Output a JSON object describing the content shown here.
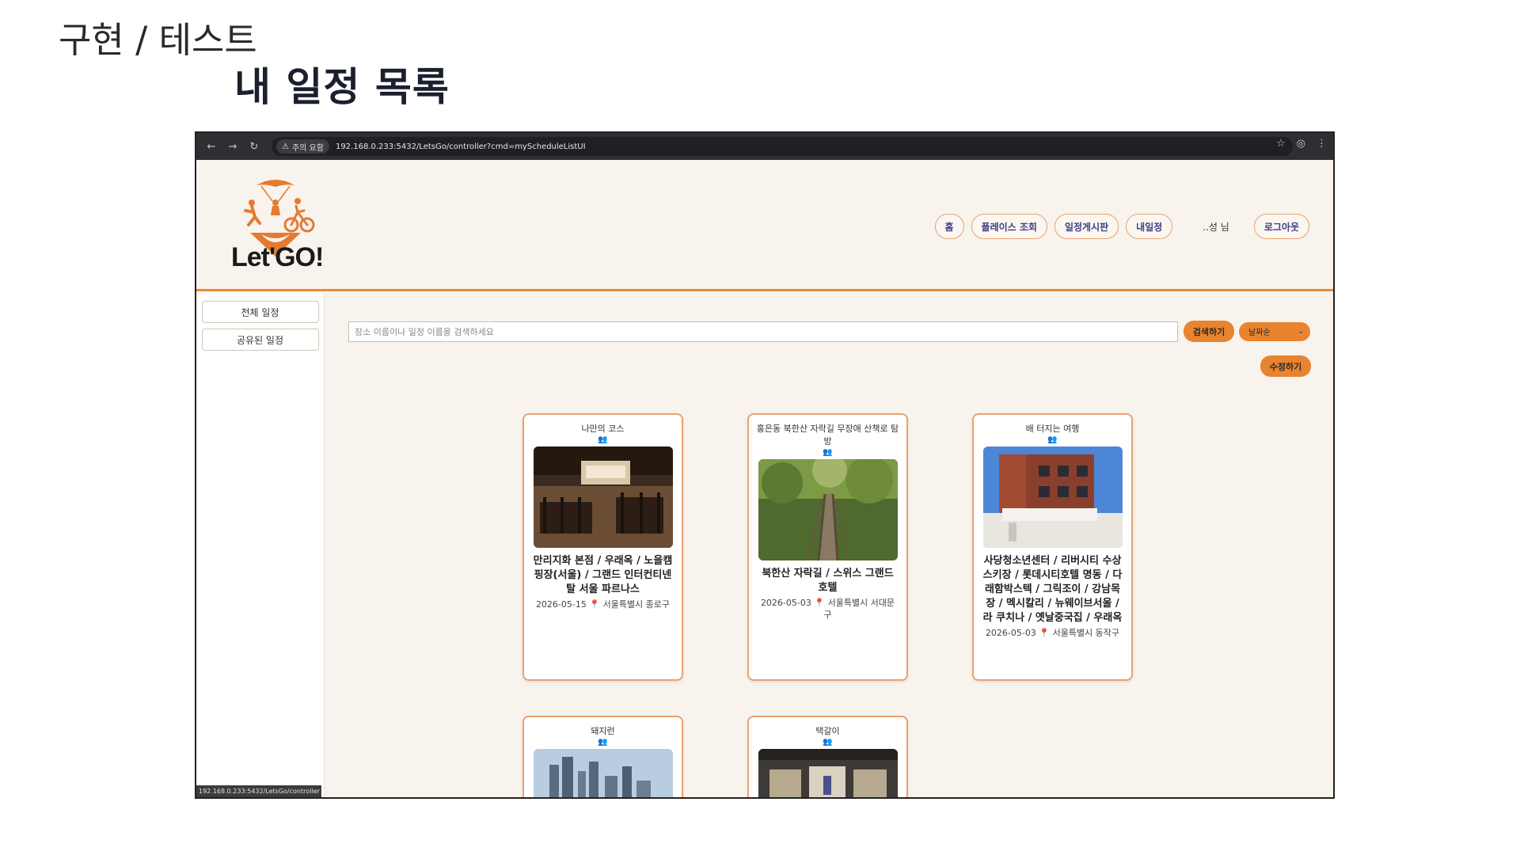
{
  "slide": {
    "title": "구현 / 테스트",
    "subtitle": "내 일정 목록"
  },
  "browser": {
    "warning": "주의 요함",
    "url": "192.168.0.233:5432/LetsGo/controller?cmd=myScheduleListUI",
    "status_url": "192.168.0.233:5432/LetsGo/controller"
  },
  "header": {
    "logo_text": "Let'GO!",
    "menu": [
      "홈",
      "플레이스 조회",
      "일정게시판",
      "내일정"
    ],
    "greeting": "..성 님",
    "logout": "로그아웃"
  },
  "sidebar": {
    "items": [
      "전체 일정",
      "공유된 일정"
    ]
  },
  "search": {
    "placeholder": "장소 이름이나 일정 이름을 검색하세요",
    "button": "검색하기",
    "sort": "날짜순"
  },
  "edit_button": "수정하기",
  "cards": [
    {
      "title": "나만의 코스",
      "places": "만리지화 본점 / 우래옥 / 노을캠핑장(서울) / 그랜드 인터컨티넨탈 서울 파르나스",
      "date": "2026-05-15",
      "location": "서울특별시 종로구"
    },
    {
      "title": "홍은동 북한산 자락길 무장애 산책로 탐방",
      "places": "북한산 자락길 / 스위스 그랜드 호텔",
      "date": "2026-05-03",
      "location": "서울특별시 서대문구"
    },
    {
      "title": "배 터지는 여행",
      "places": "사당청소년센터 / 리버시티 수상스키장 / 롯데시티호텔 명동 / 다래함박스텍 / 그릭조이 / 강남목장 / 멕시칼리 / 뉴웨이브서울 / 라 쿠치나 / 옛날중국집 / 우래옥",
      "date": "2026-05-03",
      "location": "서울특별시 동작구"
    },
    {
      "title": "돼지런",
      "places": "",
      "date": "",
      "location": ""
    },
    {
      "title": "택갈이",
      "places": "",
      "date": "",
      "location": ""
    }
  ],
  "colors": {
    "accent": "#e8832f",
    "page_bg": "#f8f3ec",
    "menu_text": "#3b3f8a"
  }
}
